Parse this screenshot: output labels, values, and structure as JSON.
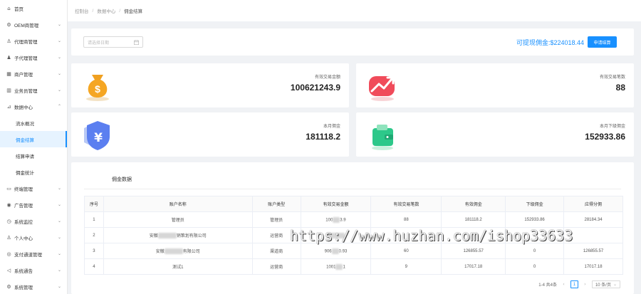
{
  "sidebar": {
    "items": [
      {
        "label": "首页",
        "icon": "home-icon",
        "glyph": "⌂",
        "chev": ""
      },
      {
        "label": "OEM商管理",
        "icon": "settings-icon",
        "glyph": "⚙",
        "chev": "⌄"
      },
      {
        "label": "代理商管理",
        "icon": "user-icon",
        "glyph": "♙",
        "chev": "⌄"
      },
      {
        "label": "子代理管理",
        "icon": "users-icon",
        "glyph": "♟",
        "chev": "⌄"
      },
      {
        "label": "商户管理",
        "icon": "store-icon",
        "glyph": "▦",
        "chev": "⌄"
      },
      {
        "label": "业务员管理",
        "icon": "briefcase-icon",
        "glyph": "▥",
        "chev": "⌄"
      },
      {
        "label": "数据中心",
        "icon": "chart-icon",
        "glyph": "⊿",
        "chev": "⌃"
      }
    ],
    "sub_items": [
      "流水概况",
      "佣金结算",
      "结算申请",
      "佣金统计"
    ],
    "items_after": [
      {
        "label": "终端管理",
        "icon": "terminal-icon",
        "glyph": "▭",
        "chev": "⌄"
      },
      {
        "label": "广告管理",
        "icon": "megaphone-icon",
        "glyph": "◉",
        "chev": "⌄"
      },
      {
        "label": "系统监控",
        "icon": "monitor-icon",
        "glyph": "◷",
        "chev": "⌄"
      },
      {
        "label": "个人中心",
        "icon": "profile-icon",
        "glyph": "♙",
        "chev": "⌄"
      },
      {
        "label": "支付通道管理",
        "icon": "channel-icon",
        "glyph": "◎",
        "chev": "⌄"
      },
      {
        "label": "系统通告",
        "icon": "notice-icon",
        "glyph": "◁",
        "chev": "⌄"
      },
      {
        "label": "系统管理",
        "icon": "gear-icon",
        "glyph": "⚙",
        "chev": "⌄"
      }
    ]
  },
  "breadcrumb": {
    "items": [
      "控制台",
      "数据中心",
      "佣金结算"
    ]
  },
  "filter": {
    "date_placeholder": "请选择日期",
    "withdraw_label": "可提现佣金:$224018.44",
    "apply_button": "申请结算"
  },
  "stats": [
    {
      "label": "有效交易金额",
      "value": "100621243.9"
    },
    {
      "label": "有效交易笔数",
      "value": "88"
    },
    {
      "label": "本月佣金",
      "value": "181118.2"
    },
    {
      "label": "本月下级佣金",
      "value": "152933.86"
    }
  ],
  "table": {
    "title": "佣金数据",
    "headers": [
      "序号",
      "账户名称",
      "账户类型",
      "有效交易金额",
      "有效交易笔数",
      "有效佣金",
      "下级佣金",
      "应得分佣"
    ],
    "rows": [
      [
        "1",
        "管理员",
        "管理员",
        "100",
        "3.9",
        "88",
        "181118.2",
        "152933.86",
        "28184.34"
      ],
      [
        "2",
        "安徽",
        "销策划有限公司",
        "运营商",
        "",
        "",
        "",
        "",
        ""
      ],
      [
        "3",
        "安徽",
        "有限公司",
        "渠道商",
        "906",
        "0.93",
        "60",
        "126855.57",
        "0",
        "126855.57"
      ],
      [
        "4",
        "测试1",
        "",
        "运营商",
        "1001",
        "1",
        "9",
        "17017.18",
        "0",
        "17017.18"
      ]
    ]
  },
  "pager": {
    "total": "1-4 共4条",
    "page": "1",
    "size": "10 条/页"
  },
  "watermark": "https://www.huzhan.com/ishop33633",
  "colors": {
    "primary": "#1890ff",
    "background": "#f0f2f5"
  }
}
